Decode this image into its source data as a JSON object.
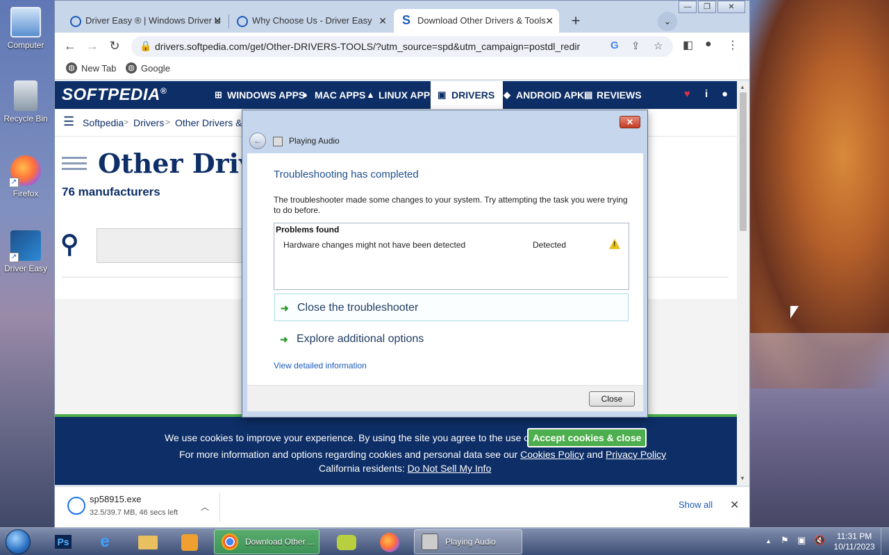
{
  "desktop": {
    "icons": [
      {
        "label": "Computer"
      },
      {
        "label": "Recycle Bin"
      },
      {
        "label": "Firefox"
      },
      {
        "label": "Driver Easy"
      }
    ]
  },
  "browser": {
    "tabs": [
      {
        "label": "Driver Easy ® | Windows Driver U"
      },
      {
        "label": "Why Choose Us - Driver Easy"
      },
      {
        "label": "Download Other Drivers & Tools"
      }
    ],
    "url": "drivers.softpedia.com/get/Other-DRIVERS-TOOLS/?utm_source=spd&utm_campaign=postdl_redir",
    "bookmarks": [
      {
        "label": "New Tab"
      },
      {
        "label": "Google"
      }
    ]
  },
  "page": {
    "logo": "SOFTPEDIA",
    "logo_mark": "®",
    "nav": [
      {
        "label": "WINDOWS APPS"
      },
      {
        "label": "MAC APPS"
      },
      {
        "label": "LINUX APPS"
      },
      {
        "label": "DRIVERS"
      },
      {
        "label": "ANDROID APK"
      },
      {
        "label": "REVIEWS"
      }
    ],
    "breadcrumb": [
      "Softpedia",
      "Drivers",
      "Other Drivers & Te"
    ],
    "title": "Other Driver",
    "manufacturers": "76 manufacturers",
    "cookie": {
      "line1": "We use cookies to improve your experience. By using the site you agree to the use of cookies.",
      "accept": "Accept cookies & close",
      "line2_prefix": "For more information and options regarding cookies and personal data see our",
      "cookies_policy": "Cookies Policy",
      "and": "and",
      "privacy_policy": "Privacy Policy",
      "line3_prefix": "California residents:",
      "do_not_sell": "Do Not Sell My Info"
    }
  },
  "downloads": {
    "file": "sp58915.exe",
    "progress": "32.5/39.7 MB, 46 secs left",
    "show_all": "Show all"
  },
  "dialog": {
    "title": "Playing Audio",
    "heading": "Troubleshooting has completed",
    "description": "The troubleshooter made some changes to your system. Try attempting the task you were trying to do before.",
    "problems_header": "Problems found",
    "problem_name": "Hardware changes might not have been detected",
    "problem_status": "Detected",
    "option1": "Close the troubleshooter",
    "option2": "Explore additional options",
    "detail_link": "View detailed information",
    "close_button": "Close"
  },
  "taskbar": {
    "windows": [
      {
        "label": "Download Other ..."
      },
      {
        "label": "Playing Audio"
      }
    ],
    "time": "11:31 PM",
    "date": "10/11/2023"
  }
}
